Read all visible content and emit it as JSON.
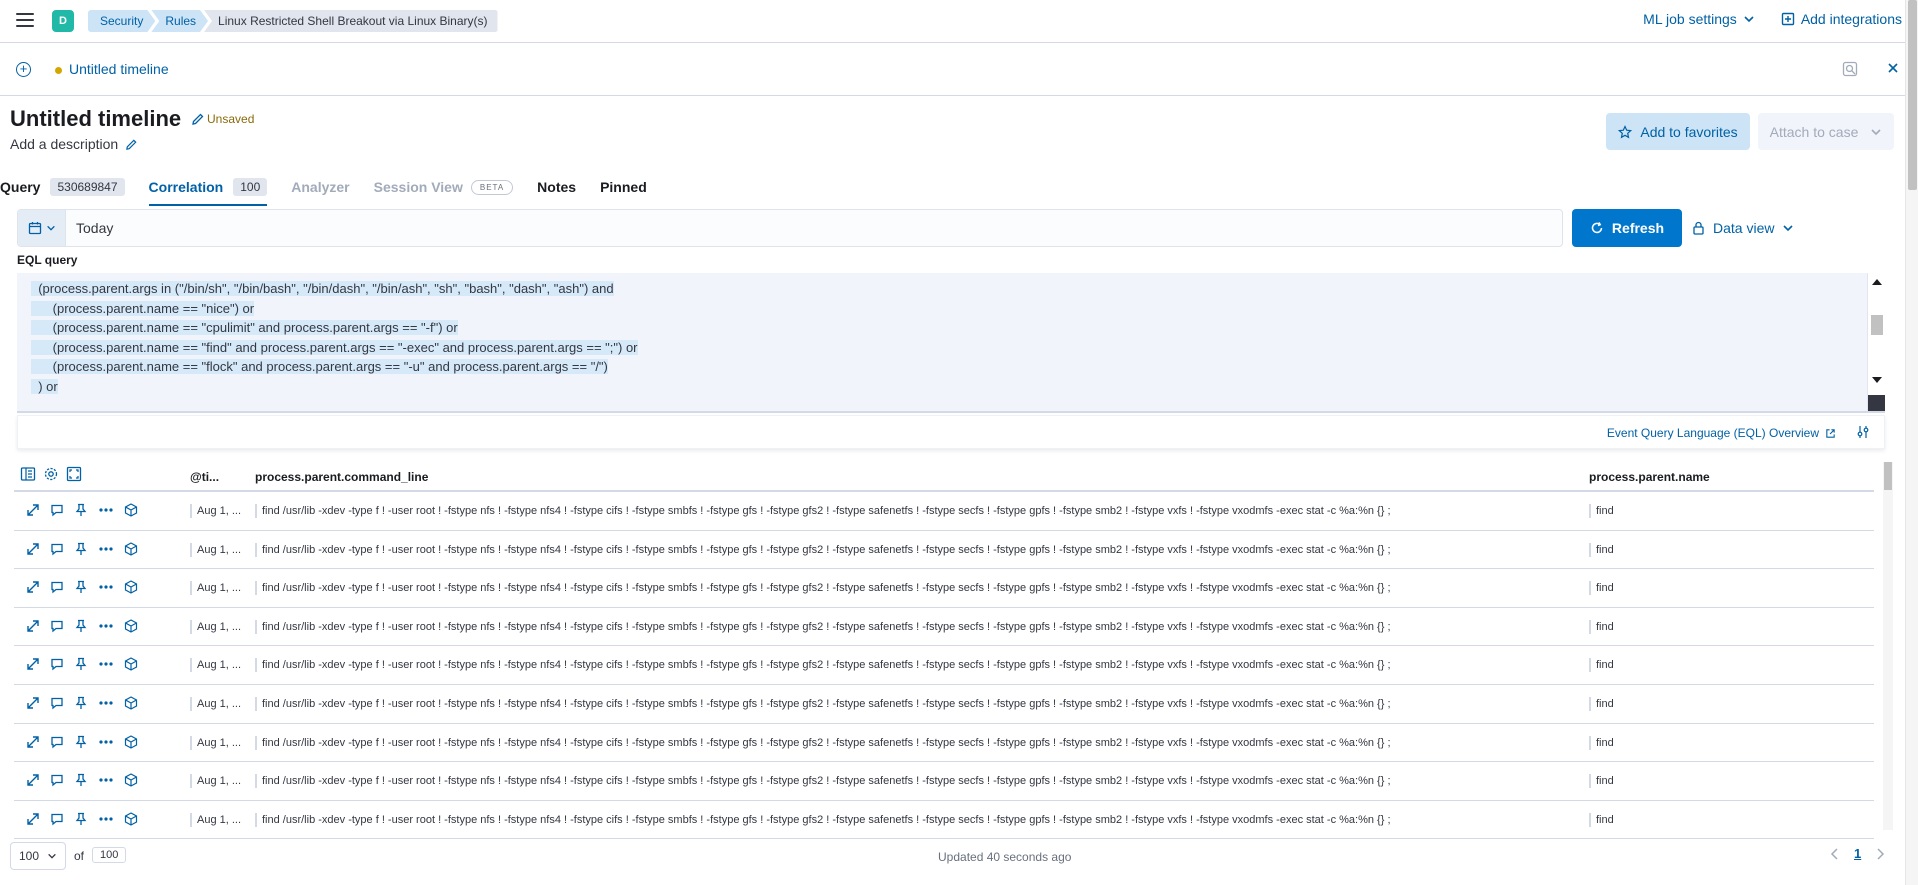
{
  "header": {
    "space_initial": "D",
    "breadcrumbs": [
      "Security",
      "Rules",
      "Linux Restricted Shell Breakout via Linux Binary(s)"
    ],
    "ml_job_settings": "ML job settings",
    "add_integrations": "Add integrations"
  },
  "timeline_tab": {
    "name": "Untitled timeline"
  },
  "timeline": {
    "title": "Untitled timeline",
    "status": "Unsaved",
    "add_description": "Add a description",
    "add_to_favorites": "Add to favorites",
    "attach_to_case": "Attach to case"
  },
  "tabs": [
    {
      "label": "Query",
      "count": "530689847"
    },
    {
      "label": "Correlation",
      "count": "100"
    },
    {
      "label": "Analyzer"
    },
    {
      "label": "Session View",
      "badge": "BETA"
    },
    {
      "label": "Notes"
    },
    {
      "label": "Pinned"
    }
  ],
  "date_picker": {
    "value": "Today",
    "refresh": "Refresh",
    "data_view": "Data view"
  },
  "eql": {
    "label": "EQL query",
    "lines": [
      "  (process.parent.args in (\"/bin/sh\", \"/bin/bash\", \"/bin/dash\", \"/bin/ash\", \"sh\", \"bash\", \"dash\", \"ash\") and",
      "      (process.parent.name == \"nice\") or",
      "      (process.parent.name == \"cpulimit\" and process.parent.args == \"-f\") or",
      "      (process.parent.name == \"find\" and process.parent.args == \"-exec\" and process.parent.args == \";\") or",
      "      (process.parent.name == \"flock\" and process.parent.args == \"-u\" and process.parent.args == \"/\")",
      "  ) or"
    ],
    "overview_link": "Event Query Language (EQL) Overview"
  },
  "table": {
    "columns": [
      "@ti...",
      "process.parent.command_line",
      "process.parent.name"
    ],
    "rows": [
      {
        "timestamp": "Aug 1, ...",
        "command_line": "find /usr/lib -xdev -type f ! -user root ! -fstype nfs ! -fstype nfs4 ! -fstype cifs ! -fstype smbfs ! -fstype gfs ! -fstype gfs2 ! -fstype safenetfs ! -fstype secfs ! -fstype gpfs ! -fstype smb2 ! -fstype vxfs ! -fstype vxodmfs -exec stat -c %a:%n {} ;",
        "name": "find"
      },
      {
        "timestamp": "Aug 1, ...",
        "command_line": "find /usr/lib -xdev -type f ! -user root ! -fstype nfs ! -fstype nfs4 ! -fstype cifs ! -fstype smbfs ! -fstype gfs ! -fstype gfs2 ! -fstype safenetfs ! -fstype secfs ! -fstype gpfs ! -fstype smb2 ! -fstype vxfs ! -fstype vxodmfs -exec stat -c %a:%n {} ;",
        "name": "find"
      },
      {
        "timestamp": "Aug 1, ...",
        "command_line": "find /usr/lib -xdev -type f ! -user root ! -fstype nfs ! -fstype nfs4 ! -fstype cifs ! -fstype smbfs ! -fstype gfs ! -fstype gfs2 ! -fstype safenetfs ! -fstype secfs ! -fstype gpfs ! -fstype smb2 ! -fstype vxfs ! -fstype vxodmfs -exec stat -c %a:%n {} ;",
        "name": "find"
      },
      {
        "timestamp": "Aug 1, ...",
        "command_line": "find /usr/lib -xdev -type f ! -user root ! -fstype nfs ! -fstype nfs4 ! -fstype cifs ! -fstype smbfs ! -fstype gfs ! -fstype gfs2 ! -fstype safenetfs ! -fstype secfs ! -fstype gpfs ! -fstype smb2 ! -fstype vxfs ! -fstype vxodmfs -exec stat -c %a:%n {} ;",
        "name": "find"
      },
      {
        "timestamp": "Aug 1, ...",
        "command_line": "find /usr/lib -xdev -type f ! -user root ! -fstype nfs ! -fstype nfs4 ! -fstype cifs ! -fstype smbfs ! -fstype gfs ! -fstype gfs2 ! -fstype safenetfs ! -fstype secfs ! -fstype gpfs ! -fstype smb2 ! -fstype vxfs ! -fstype vxodmfs -exec stat -c %a:%n {} ;",
        "name": "find"
      },
      {
        "timestamp": "Aug 1, ...",
        "command_line": "find /usr/lib -xdev -type f ! -user root ! -fstype nfs ! -fstype nfs4 ! -fstype cifs ! -fstype smbfs ! -fstype gfs ! -fstype gfs2 ! -fstype safenetfs ! -fstype secfs ! -fstype gpfs ! -fstype smb2 ! -fstype vxfs ! -fstype vxodmfs -exec stat -c %a:%n {} ;",
        "name": "find"
      },
      {
        "timestamp": "Aug 1, ...",
        "command_line": "find /usr/lib -xdev -type f ! -user root ! -fstype nfs ! -fstype nfs4 ! -fstype cifs ! -fstype smbfs ! -fstype gfs ! -fstype gfs2 ! -fstype safenetfs ! -fstype secfs ! -fstype gpfs ! -fstype smb2 ! -fstype vxfs ! -fstype vxodmfs -exec stat -c %a:%n {} ;",
        "name": "find"
      },
      {
        "timestamp": "Aug 1, ...",
        "command_line": "find /usr/lib -xdev -type f ! -user root ! -fstype nfs ! -fstype nfs4 ! -fstype cifs ! -fstype smbfs ! -fstype gfs ! -fstype gfs2 ! -fstype safenetfs ! -fstype secfs ! -fstype gpfs ! -fstype smb2 ! -fstype vxfs ! -fstype vxodmfs -exec stat -c %a:%n {} ;",
        "name": "find"
      },
      {
        "timestamp": "Aug 1, ...",
        "command_line": "find /usr/lib -xdev -type f ! -user root ! -fstype nfs ! -fstype nfs4 ! -fstype cifs ! -fstype smbfs ! -fstype gfs ! -fstype gfs2 ! -fstype safenetfs ! -fstype secfs ! -fstype gpfs ! -fstype smb2 ! -fstype vxfs ! -fstype vxodmfs -exec stat -c %a:%n {} ;",
        "name": "find"
      }
    ]
  },
  "footer": {
    "rows_per_page": "100",
    "of_label": "of",
    "total": "100",
    "updated": "Updated 40 seconds ago",
    "current_page": "1"
  },
  "colors": {
    "accent": "#0077cc",
    "link": "#0061a6",
    "space_avatar": "#20b8a6",
    "unsaved_dot": "#d6a600"
  }
}
